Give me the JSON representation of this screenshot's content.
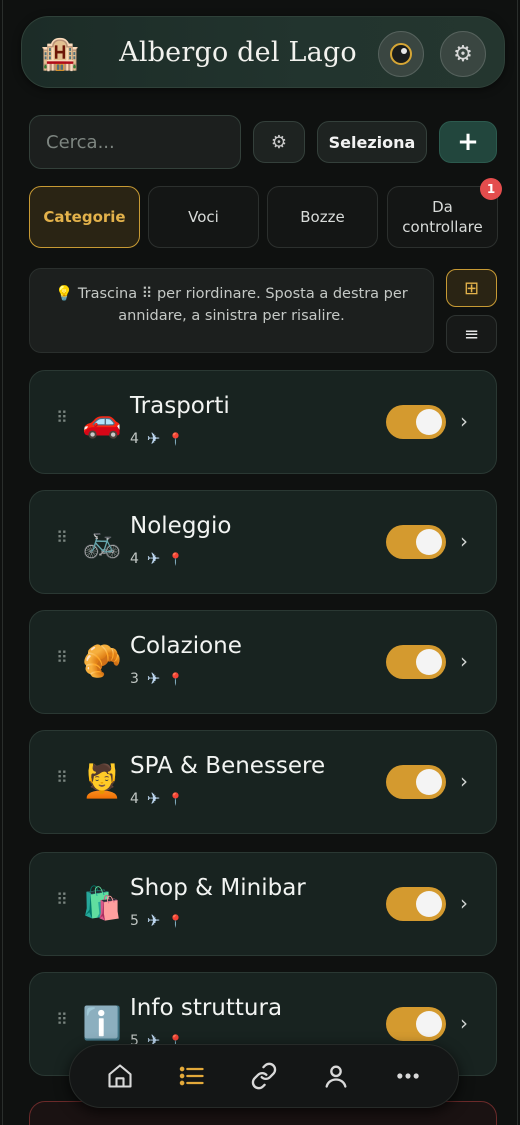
{
  "header": {
    "logo_icon": "hotel-building-emoji",
    "title": "Albergo del Lago",
    "theme_icon": "theme-toggle-icon",
    "settings_icon": "gear-icon"
  },
  "toolbar": {
    "search_placeholder": "Cerca...",
    "filter_icon": "gear-icon",
    "select_label": "Seleziona",
    "add_label": "+"
  },
  "tabs": [
    {
      "label": "Categorie",
      "active": true
    },
    {
      "label": "Voci",
      "active": false
    },
    {
      "label": "Bozze",
      "active": false
    },
    {
      "label": "Da controllare",
      "active": false,
      "badge": "1"
    }
  ],
  "hint": {
    "icon": "💡",
    "text": "Trascina ⠿ per riordinare. Sposta a destra per annidare, a sinistra per risalire."
  },
  "view_toggle": {
    "grid_icon": "⊞",
    "list_icon": "≡",
    "active": "grid"
  },
  "categories": [
    {
      "emoji": "🚗",
      "name": "Trasporti",
      "count": "4",
      "enabled": true
    },
    {
      "emoji": "🚲",
      "name": "Noleggio",
      "count": "4",
      "enabled": true
    },
    {
      "emoji": "🥐",
      "name": "Colazione",
      "count": "3",
      "enabled": true
    },
    {
      "emoji": "💆",
      "name": "SPA & Benessere",
      "count": "4",
      "enabled": true
    },
    {
      "emoji": "🛍️",
      "name": "Shop & Minibar",
      "count": "5",
      "enabled": true
    },
    {
      "emoji": "ℹ️",
      "name": "Info struttura",
      "count": "5",
      "enabled": true
    }
  ],
  "bottom_nav": [
    {
      "name": "home",
      "active": false
    },
    {
      "name": "list",
      "active": true
    },
    {
      "name": "link",
      "active": false
    },
    {
      "name": "profile",
      "active": false
    },
    {
      "name": "more",
      "active": false
    }
  ],
  "colors": {
    "accent": "#d49a2f",
    "background": "#0f1110",
    "card": "#182320",
    "badge": "#e44d4d"
  }
}
